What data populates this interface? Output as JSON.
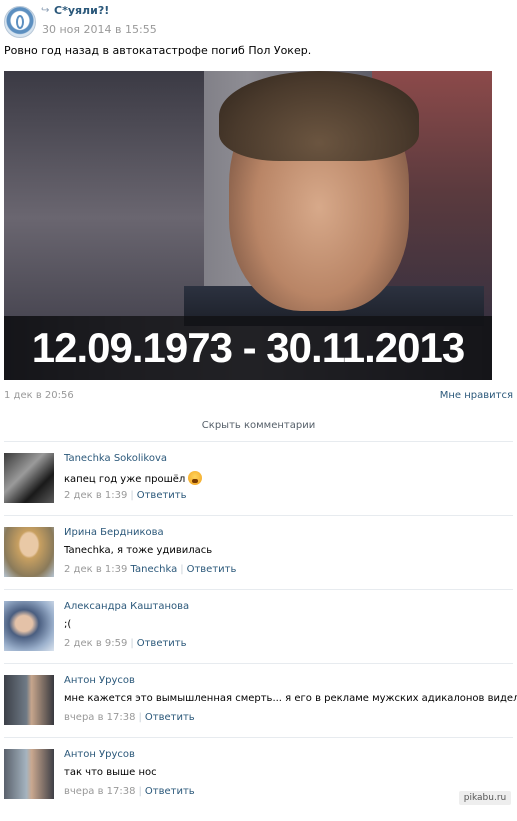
{
  "post": {
    "repost_icon": "↪",
    "group_name": "С*уяли?!",
    "date": "30 ноя 2014 в 15:55",
    "text": "Ровно год назад в автокатастрофе погиб Пол Уокер.",
    "photo_caption": "12.09.1973 - 30.11.2013",
    "meta_date": "1 дек в 20:56",
    "like_label": "Мне нравится"
  },
  "comments_toggle": "Скрыть комментарии",
  "comments": [
    {
      "name": "Tanechka Sokolikova",
      "text": "капец год уже прошёл",
      "date": "2 дек в 1:39",
      "mention": "",
      "reply": "Ответить",
      "emoji": true
    },
    {
      "name": "Ирина Бердникова",
      "text": "Tanechka, я тоже удивилась",
      "date": "2 дек в 1:39",
      "mention": "Tanechka",
      "reply": "Ответить",
      "emoji": false
    },
    {
      "name": "Александра Каштанова",
      "text": ";(",
      "date": "2 дек в 9:59",
      "mention": "",
      "reply": "Ответить",
      "emoji": false
    },
    {
      "name": "Антон Урусов",
      "text": "мне кажется это вымышленная смерть... я его в рекламе мужских адикалонов видел)))",
      "date": "вчера в 17:38",
      "mention": "",
      "reply": "Ответить",
      "emoji": false
    },
    {
      "name": "Антон Урусов",
      "text": "так что выше нос",
      "date": "вчера в 17:38",
      "mention": "",
      "reply": "Ответить",
      "emoji": false
    }
  ],
  "watermark": "pikabu.ru"
}
